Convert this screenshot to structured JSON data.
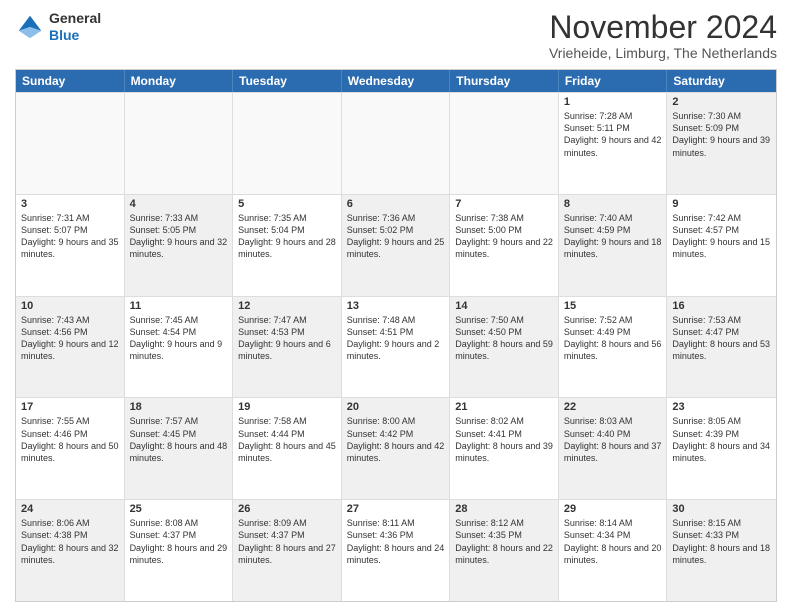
{
  "logo": {
    "general": "General",
    "blue": "Blue"
  },
  "header": {
    "month_title": "November 2024",
    "location": "Vrieheide, Limburg, The Netherlands"
  },
  "days_of_week": [
    "Sunday",
    "Monday",
    "Tuesday",
    "Wednesday",
    "Thursday",
    "Friday",
    "Saturday"
  ],
  "rows": [
    [
      {
        "day": "",
        "info": "",
        "empty": true
      },
      {
        "day": "",
        "info": "",
        "empty": true
      },
      {
        "day": "",
        "info": "",
        "empty": true
      },
      {
        "day": "",
        "info": "",
        "empty": true
      },
      {
        "day": "",
        "info": "",
        "empty": true
      },
      {
        "day": "1",
        "info": "Sunrise: 7:28 AM\nSunset: 5:11 PM\nDaylight: 9 hours and 42 minutes.",
        "empty": false
      },
      {
        "day": "2",
        "info": "Sunrise: 7:30 AM\nSunset: 5:09 PM\nDaylight: 9 hours and 39 minutes.",
        "empty": false,
        "shaded": true
      }
    ],
    [
      {
        "day": "3",
        "info": "Sunrise: 7:31 AM\nSunset: 5:07 PM\nDaylight: 9 hours and 35 minutes.",
        "empty": false
      },
      {
        "day": "4",
        "info": "Sunrise: 7:33 AM\nSunset: 5:05 PM\nDaylight: 9 hours and 32 minutes.",
        "empty": false,
        "shaded": true
      },
      {
        "day": "5",
        "info": "Sunrise: 7:35 AM\nSunset: 5:04 PM\nDaylight: 9 hours and 28 minutes.",
        "empty": false
      },
      {
        "day": "6",
        "info": "Sunrise: 7:36 AM\nSunset: 5:02 PM\nDaylight: 9 hours and 25 minutes.",
        "empty": false,
        "shaded": true
      },
      {
        "day": "7",
        "info": "Sunrise: 7:38 AM\nSunset: 5:00 PM\nDaylight: 9 hours and 22 minutes.",
        "empty": false
      },
      {
        "day": "8",
        "info": "Sunrise: 7:40 AM\nSunset: 4:59 PM\nDaylight: 9 hours and 18 minutes.",
        "empty": false,
        "shaded": true
      },
      {
        "day": "9",
        "info": "Sunrise: 7:42 AM\nSunset: 4:57 PM\nDaylight: 9 hours and 15 minutes.",
        "empty": false
      }
    ],
    [
      {
        "day": "10",
        "info": "Sunrise: 7:43 AM\nSunset: 4:56 PM\nDaylight: 9 hours and 12 minutes.",
        "empty": false,
        "shaded": true
      },
      {
        "day": "11",
        "info": "Sunrise: 7:45 AM\nSunset: 4:54 PM\nDaylight: 9 hours and 9 minutes.",
        "empty": false
      },
      {
        "day": "12",
        "info": "Sunrise: 7:47 AM\nSunset: 4:53 PM\nDaylight: 9 hours and 6 minutes.",
        "empty": false,
        "shaded": true
      },
      {
        "day": "13",
        "info": "Sunrise: 7:48 AM\nSunset: 4:51 PM\nDaylight: 9 hours and 2 minutes.",
        "empty": false
      },
      {
        "day": "14",
        "info": "Sunrise: 7:50 AM\nSunset: 4:50 PM\nDaylight: 8 hours and 59 minutes.",
        "empty": false,
        "shaded": true
      },
      {
        "day": "15",
        "info": "Sunrise: 7:52 AM\nSunset: 4:49 PM\nDaylight: 8 hours and 56 minutes.",
        "empty": false
      },
      {
        "day": "16",
        "info": "Sunrise: 7:53 AM\nSunset: 4:47 PM\nDaylight: 8 hours and 53 minutes.",
        "empty": false,
        "shaded": true
      }
    ],
    [
      {
        "day": "17",
        "info": "Sunrise: 7:55 AM\nSunset: 4:46 PM\nDaylight: 8 hours and 50 minutes.",
        "empty": false
      },
      {
        "day": "18",
        "info": "Sunrise: 7:57 AM\nSunset: 4:45 PM\nDaylight: 8 hours and 48 minutes.",
        "empty": false,
        "shaded": true
      },
      {
        "day": "19",
        "info": "Sunrise: 7:58 AM\nSunset: 4:44 PM\nDaylight: 8 hours and 45 minutes.",
        "empty": false
      },
      {
        "day": "20",
        "info": "Sunrise: 8:00 AM\nSunset: 4:42 PM\nDaylight: 8 hours and 42 minutes.",
        "empty": false,
        "shaded": true
      },
      {
        "day": "21",
        "info": "Sunrise: 8:02 AM\nSunset: 4:41 PM\nDaylight: 8 hours and 39 minutes.",
        "empty": false
      },
      {
        "day": "22",
        "info": "Sunrise: 8:03 AM\nSunset: 4:40 PM\nDaylight: 8 hours and 37 minutes.",
        "empty": false,
        "shaded": true
      },
      {
        "day": "23",
        "info": "Sunrise: 8:05 AM\nSunset: 4:39 PM\nDaylight: 8 hours and 34 minutes.",
        "empty": false
      }
    ],
    [
      {
        "day": "24",
        "info": "Sunrise: 8:06 AM\nSunset: 4:38 PM\nDaylight: 8 hours and 32 minutes.",
        "empty": false,
        "shaded": true
      },
      {
        "day": "25",
        "info": "Sunrise: 8:08 AM\nSunset: 4:37 PM\nDaylight: 8 hours and 29 minutes.",
        "empty": false
      },
      {
        "day": "26",
        "info": "Sunrise: 8:09 AM\nSunset: 4:37 PM\nDaylight: 8 hours and 27 minutes.",
        "empty": false,
        "shaded": true
      },
      {
        "day": "27",
        "info": "Sunrise: 8:11 AM\nSunset: 4:36 PM\nDaylight: 8 hours and 24 minutes.",
        "empty": false
      },
      {
        "day": "28",
        "info": "Sunrise: 8:12 AM\nSunset: 4:35 PM\nDaylight: 8 hours and 22 minutes.",
        "empty": false,
        "shaded": true
      },
      {
        "day": "29",
        "info": "Sunrise: 8:14 AM\nSunset: 4:34 PM\nDaylight: 8 hours and 20 minutes.",
        "empty": false
      },
      {
        "day": "30",
        "info": "Sunrise: 8:15 AM\nSunset: 4:33 PM\nDaylight: 8 hours and 18 minutes.",
        "empty": false,
        "shaded": true
      }
    ]
  ]
}
